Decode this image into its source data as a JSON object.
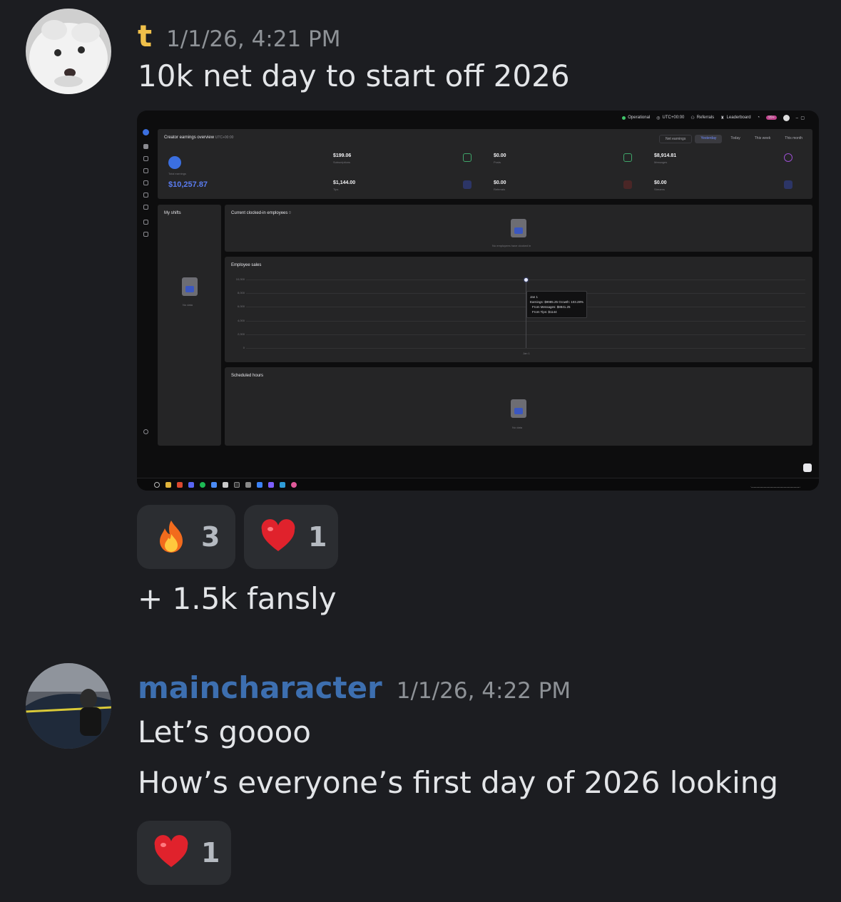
{
  "messages": [
    {
      "username": "t",
      "username_color": "#f0c04a",
      "timestamp": "1/1/26, 4:21 PM",
      "lines": [
        "10k net day to start off 2026"
      ],
      "reactions": [
        {
          "emoji": "fire-icon",
          "count": "3"
        },
        {
          "emoji": "heart-icon",
          "count": "1"
        }
      ],
      "followup": "+ 1.5k fansly"
    },
    {
      "username": "maincharacter",
      "username_color": "#3d6fb0",
      "timestamp": "1/1/26, 4:22 PM",
      "lines": [
        "Let’s goooo",
        "How’s everyone’s first day of 2026 looking"
      ],
      "reactions": [
        {
          "emoji": "heart-icon",
          "count": "1"
        }
      ]
    }
  ],
  "screenshot": {
    "topbar": {
      "status": "Operational",
      "timezone": "UTC+00:00",
      "referrals": "Referrals",
      "leaderboard": "Leaderboard",
      "badge": "99+"
    },
    "overview": {
      "title": "Creator earnings overview",
      "timezone": "UTC+00:00",
      "filter": "Net earnings",
      "tabs": [
        "Yesterday",
        "Today",
        "This week",
        "This month"
      ],
      "active_tab": "Yesterday",
      "total_label": "Total earnings",
      "total_value": "$10,257.87",
      "cards": [
        {
          "value": "$199.06",
          "label": "Subscriptions",
          "color": "#3fa66a"
        },
        {
          "value": "$0.00",
          "label": "Posts",
          "color": "#3fa66a"
        },
        {
          "value": "$8,914.81",
          "label": "Messages",
          "color": "#9a4fd0"
        },
        {
          "value": "$1,144.00",
          "label": "Tips",
          "color": "#3b57c0"
        },
        {
          "value": "$0.00",
          "label": "Referrals",
          "color": "#c04a4a"
        },
        {
          "value": "$0.00",
          "label": "Streams",
          "color": "#3b57c0"
        }
      ]
    },
    "my_shifts": {
      "title": "My shifts",
      "empty": "No data"
    },
    "clocked_in": {
      "title": "Current clocked-in employees",
      "count": "0",
      "empty": "No employees have clocked in"
    },
    "employee_sales": {
      "title": "Employee sales",
      "tooltip": {
        "date": "Jan 1",
        "line1": "Earnings: $9985.25 Growth: 103.28%",
        "line2": "From Messages: $8841.25",
        "line3": "From Tips: $1144"
      }
    },
    "scheduled_hours": {
      "title": "Scheduled hours",
      "empty": "No data"
    }
  },
  "chart_data": {
    "type": "line",
    "title": "Employee sales",
    "categories": [
      "Jan 1"
    ],
    "values": [
      9985.25
    ],
    "yticks": [
      "10,000",
      "8,000",
      "6,000",
      "4,000",
      "2,000",
      "0"
    ],
    "ylim": [
      0,
      10000
    ]
  }
}
